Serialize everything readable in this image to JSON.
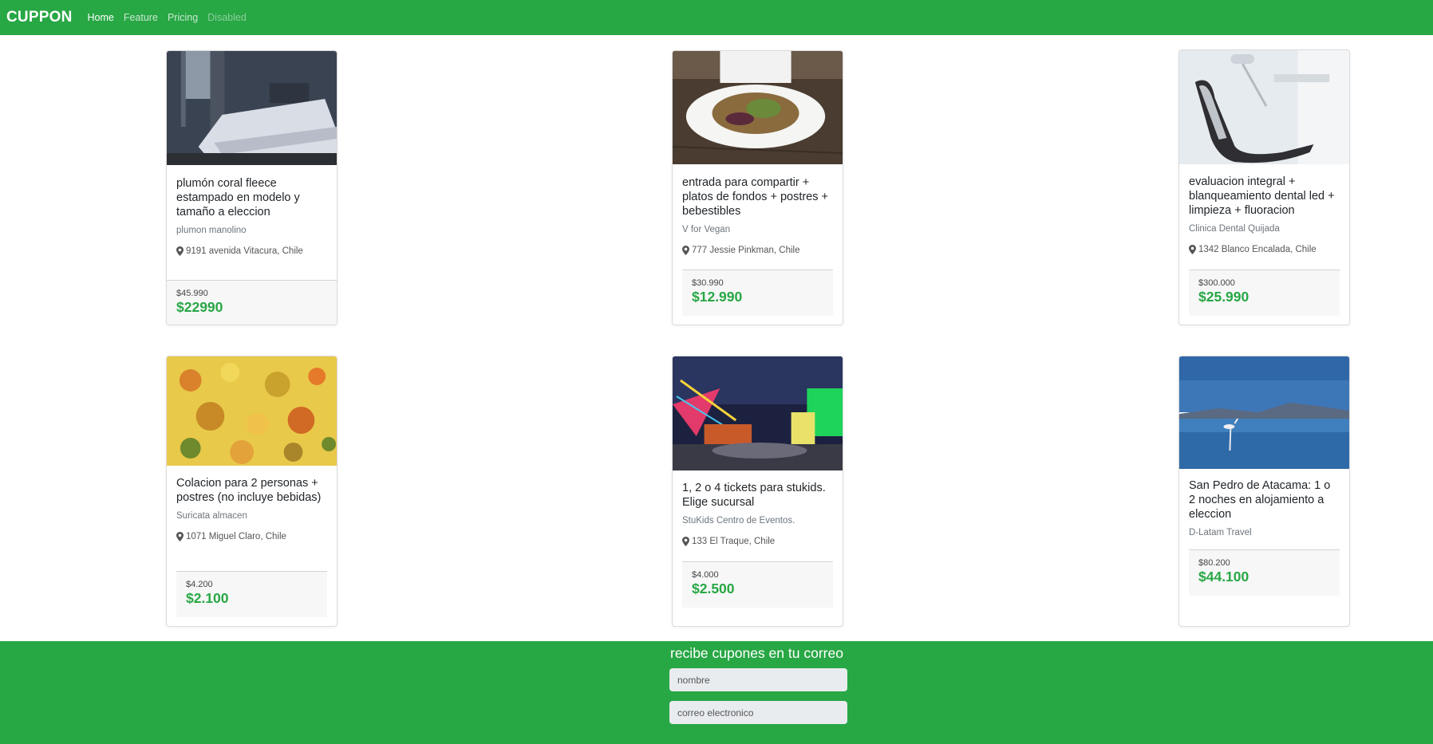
{
  "navbar": {
    "brand": "CUPPON",
    "links": [
      {
        "label": "Home",
        "state": "active"
      },
      {
        "label": "Feature",
        "state": "normal"
      },
      {
        "label": "Pricing",
        "state": "normal"
      },
      {
        "label": "Disabled",
        "state": "disabled"
      }
    ]
  },
  "colors": {
    "accent": "#28a745",
    "card_border": "#dedede",
    "price_box": "#f7f7f7"
  },
  "cards": [
    {
      "title": "plumón coral fleece estampado en modelo y tamaño a eleccion",
      "merchant": "plumon manolino",
      "location": "9191 avenida Vitacura, Chile",
      "price_old": "$45.990",
      "price_new": "$22990",
      "image": "bedroom-photo"
    },
    {
      "title": "entrada para compartir + platos de fondos + postres + bebestibles",
      "merchant": "V for Vegan",
      "location": "777 Jessie Pinkman, Chile",
      "price_old": "$30.990",
      "price_new": "$12.990",
      "image": "salad-plate-photo"
    },
    {
      "title": "evaluacion integral + blanqueamiento dental led + limpieza + fluoracion",
      "merchant": "Clinica Dental Quijada",
      "location": "1342 Blanco Encalada, Chile",
      "price_old": "$300.000",
      "price_new": "$25.990",
      "image": "dental-chair-photo"
    },
    {
      "title": "Colacion para 2 personas + postres (no incluye bebidas)",
      "merchant": "Suricata almacen",
      "location": "1071 Miguel Claro, Chile",
      "price_old": "$4.200",
      "price_new": "$2.100",
      "image": "stew-food-photo"
    },
    {
      "title": "1, 2 o 4 tickets para stukids. Elige sucursal",
      "merchant": "StuKids Centro de Eventos.",
      "location": "133 El Traque, Chile",
      "price_old": "$4.000",
      "price_new": "$2.500",
      "image": "fairground-night-photo"
    },
    {
      "title": "San Pedro de Atacama: 1 o 2 noches en alojamiento a eleccion",
      "merchant": "D-Latam Travel",
      "location": "",
      "price_old": "$80.200",
      "price_new": "$44.100",
      "image": "salt-lake-flamingo-photo"
    }
  ],
  "footer": {
    "title": "recibe cupones en tu correo",
    "name_placeholder": "nombre",
    "email_placeholder": "correo electronico"
  }
}
